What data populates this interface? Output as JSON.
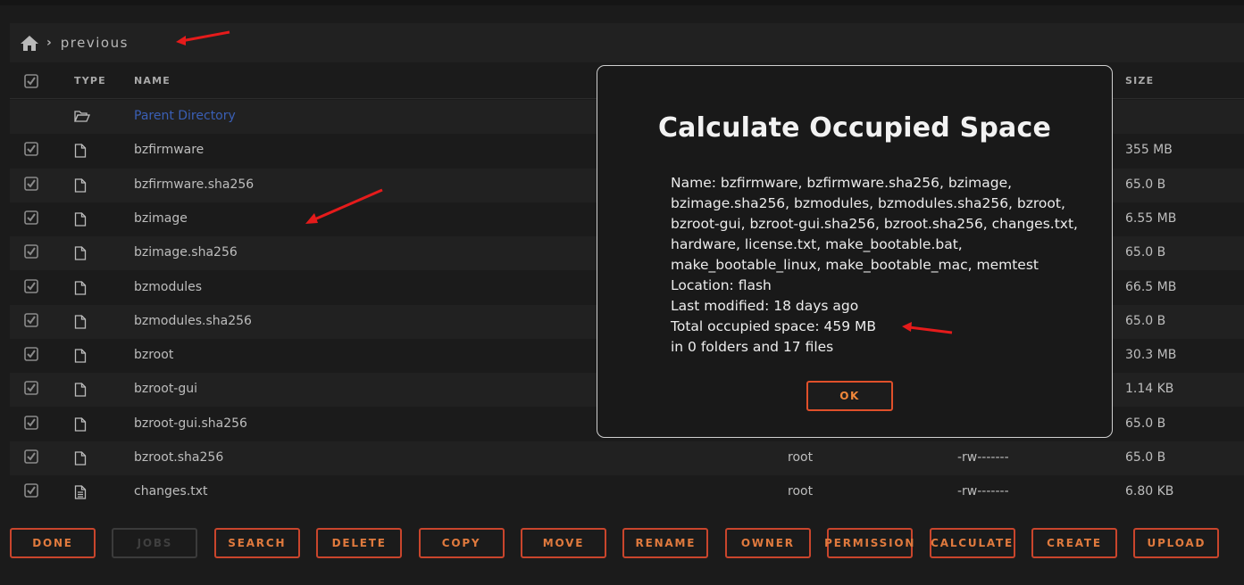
{
  "breadcrumb": {
    "home_icon": "home-icon",
    "current": "previous"
  },
  "table": {
    "headers": {
      "type": "TYPE",
      "name": "NAME",
      "size": "SIZE"
    },
    "parent": "Parent Directory",
    "rows": [
      {
        "name": "bzfirmware",
        "owner": "",
        "perms": "",
        "size": "355 MB",
        "icon": "file-icon"
      },
      {
        "name": "bzfirmware.sha256",
        "owner": "",
        "perms": "",
        "size": "65.0 B",
        "icon": "file-icon"
      },
      {
        "name": "bzimage",
        "owner": "",
        "perms": "",
        "size": "6.55 MB",
        "icon": "file-icon"
      },
      {
        "name": "bzimage.sha256",
        "owner": "",
        "perms": "",
        "size": "65.0 B",
        "icon": "file-icon"
      },
      {
        "name": "bzmodules",
        "owner": "",
        "perms": "",
        "size": "66.5 MB",
        "icon": "file-icon"
      },
      {
        "name": "bzmodules.sha256",
        "owner": "",
        "perms": "",
        "size": "65.0 B",
        "icon": "file-icon"
      },
      {
        "name": "bzroot",
        "owner": "",
        "perms": "",
        "size": "30.3 MB",
        "icon": "file-icon"
      },
      {
        "name": "bzroot-gui",
        "owner": "",
        "perms": "",
        "size": "1.14 KB",
        "icon": "file-icon"
      },
      {
        "name": "bzroot-gui.sha256",
        "owner": "",
        "perms": "",
        "size": "65.0 B",
        "icon": "file-icon"
      },
      {
        "name": "bzroot.sha256",
        "owner": "root",
        "perms": "-rw-------",
        "size": "65.0 B",
        "icon": "file-icon"
      },
      {
        "name": "changes.txt",
        "owner": "root",
        "perms": "-rw-------",
        "size": "6.80 KB",
        "icon": "text-file-icon"
      }
    ]
  },
  "modal": {
    "title": "Calculate Occupied Space",
    "name_line": "Name: bzfirmware, bzfirmware.sha256, bzimage, bzimage.sha256, bzmodules, bzmodules.sha256, bzroot, bzroot-gui, bzroot-gui.sha256, bzroot.sha256, changes.txt, hardware, license.txt, make_bootable.bat, make_bootable_linux, make_bootable_mac, memtest",
    "location_line": "Location: flash",
    "modified_line": "Last modified: 18 days ago",
    "total_line": "Total occupied space: 459 MB",
    "count_line": "in 0 folders and 17 files",
    "ok_label": "OK"
  },
  "buttons": [
    {
      "label": "DONE",
      "enabled": true
    },
    {
      "label": "JOBS",
      "enabled": false
    },
    {
      "label": "SEARCH",
      "enabled": true
    },
    {
      "label": "DELETE",
      "enabled": true
    },
    {
      "label": "COPY",
      "enabled": true
    },
    {
      "label": "MOVE",
      "enabled": true
    },
    {
      "label": "RENAME",
      "enabled": true
    },
    {
      "label": "OWNER",
      "enabled": true
    },
    {
      "label": "PERMISSION",
      "enabled": true
    },
    {
      "label": "CALCULATE",
      "enabled": true
    },
    {
      "label": "CREATE",
      "enabled": true
    },
    {
      "label": "UPLOAD",
      "enabled": true
    }
  ],
  "colors": {
    "accent": "#e0502a",
    "link": "#3a5fb5",
    "annotation": "#e51b1b"
  }
}
